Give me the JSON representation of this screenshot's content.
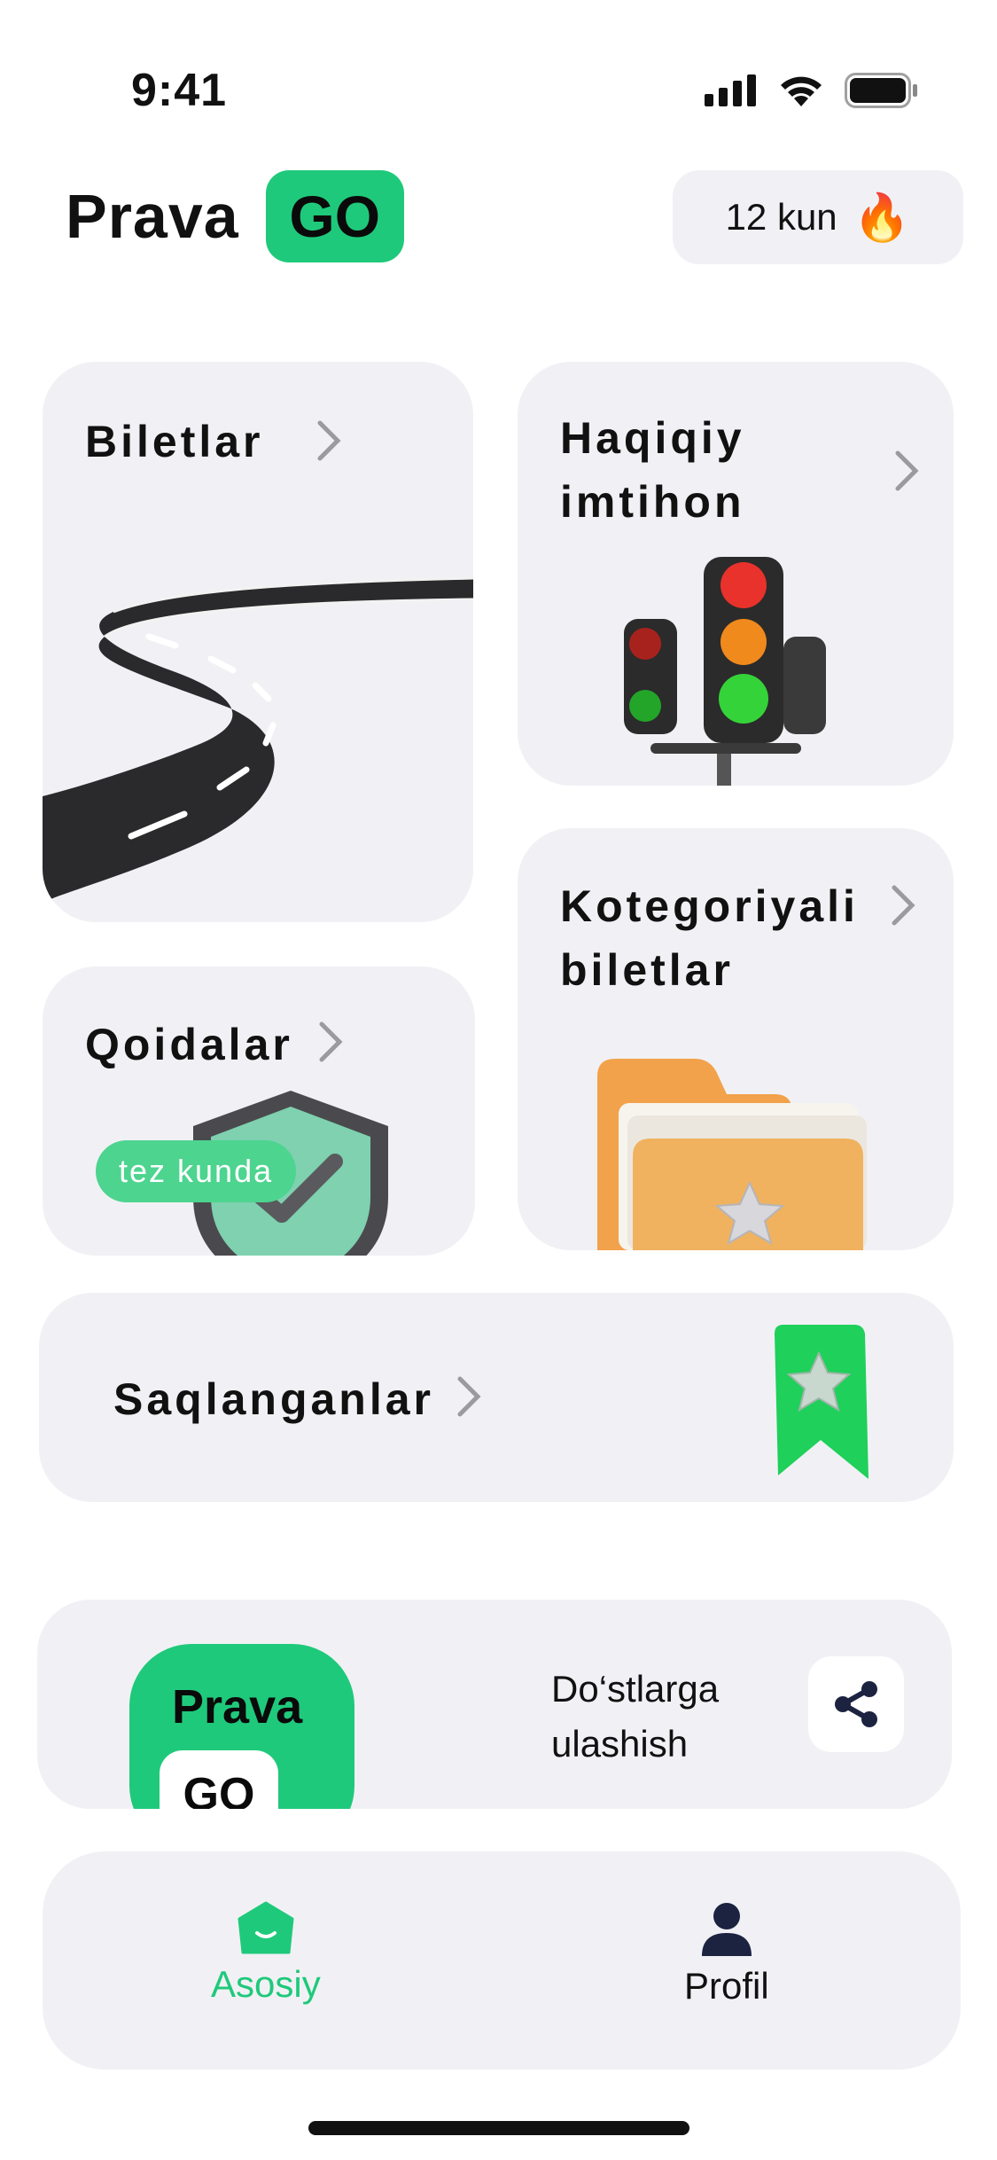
{
  "status_bar": {
    "time": "9:41"
  },
  "header": {
    "logo_text": "Prava",
    "logo_badge": "GO",
    "streak_label": "12 kun",
    "streak_emoji": "🔥"
  },
  "cards": {
    "biletlar": {
      "title": "Biletlar"
    },
    "haqiqiy": {
      "title_line1": "Haqiqiy",
      "title_line2": "imtihon"
    },
    "qoidalar": {
      "title": "Qoidalar",
      "badge": "tez kunda"
    },
    "kategoriya": {
      "title_line1": "Kotegoriyali",
      "title_line2": "biletlar"
    },
    "saqlanganlar": {
      "title": "Saqlanganlar"
    }
  },
  "share": {
    "app_icon_text": "Prava",
    "app_icon_badge": "GO",
    "text_line1": "Do‘stlarga",
    "text_line2": "ulashish"
  },
  "tabbar": {
    "home_label": "Asosiy",
    "profile_label": "Profil"
  },
  "colors": {
    "accent": "#1fc97b",
    "card_bg": "#f1f1f5",
    "nav_dark": "#1c2340"
  }
}
